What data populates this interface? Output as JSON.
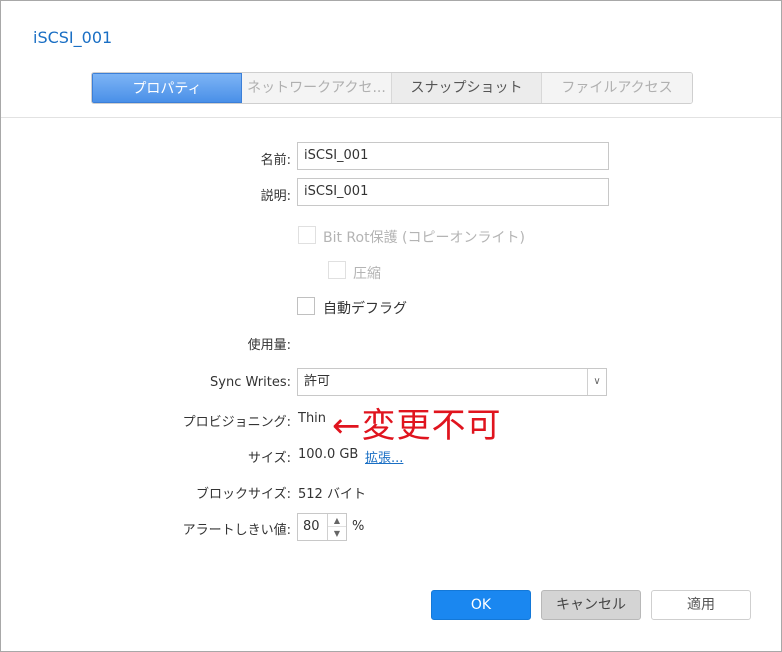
{
  "dialog": {
    "title": "iSCSI_001"
  },
  "tabs": [
    {
      "label": "プロパティ",
      "state": "active"
    },
    {
      "label": "ネットワークアクセ...",
      "state": "disabled"
    },
    {
      "label": "スナップショット",
      "state": "normal"
    },
    {
      "label": "ファイルアクセス",
      "state": "disabled"
    }
  ],
  "form": {
    "name_label": "名前:",
    "name_value": "iSCSI_001",
    "desc_label": "説明:",
    "desc_value": "iSCSI_001",
    "bitrot_label": "Bit Rot保護 (コピーオンライト)",
    "compression_label": "圧縮",
    "defrag_label": "自動デフラグ",
    "usage_label": "使用量:",
    "sync_label": "Sync Writes:",
    "sync_value": "許可",
    "provision_label": "プロビジョニング:",
    "provision_value": "Thin",
    "size_label": "サイズ:",
    "size_value": "100.0 GB",
    "expand_link": "拡張...",
    "block_label": "ブロックサイズ:",
    "block_value": "512 バイト",
    "alert_label": "アラートしきい値:",
    "alert_value": "80",
    "alert_unit": "%"
  },
  "annotation": {
    "text": "←変更不可",
    "color": "#e0141e"
  },
  "buttons": {
    "ok": "OK",
    "cancel": "キャンセル",
    "apply": "適用"
  }
}
